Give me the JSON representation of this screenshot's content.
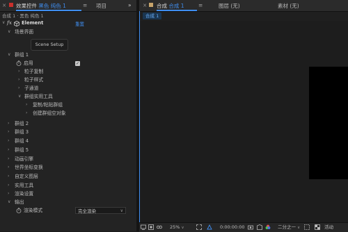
{
  "left_panel": {
    "tab_label_prefix": "效果控件",
    "tab_label_layer": "黑色 纯色 1",
    "tab_menu_glyph": "≡",
    "project_tab": "项目",
    "overflow_glyph": "»",
    "breadcrumb": "合成 1 · 黑色 纯色 1",
    "effect": {
      "fx_label": "fx",
      "name": "Element",
      "reset_label": "重置"
    },
    "scene_section": "场景界面",
    "scene_button": "Scene Setup",
    "group1": {
      "label": "群组 1",
      "enable_label": "启用",
      "items": [
        "粒子复制",
        "粒子样式",
        "子通道",
        "群组实用工具"
      ],
      "sub_items": [
        "复制/粘贴群组",
        "创建群组空对象"
      ]
    },
    "groups_collapsed": [
      "群组 2",
      "群组 3",
      "群组 4",
      "群组 5"
    ],
    "sections": [
      "动画引擎",
      "世界坐标变换",
      "自定义图层",
      "实用工具",
      "渲染设置",
      "输出"
    ],
    "render_mode_label": "渲染模式",
    "render_mode_value": "完全渲染"
  },
  "right_panel": {
    "comp_tab_prefix": "合成",
    "comp_tab_name": "合成 1",
    "comp_tab_menu": "≡",
    "layer_tab": "图层 (无)",
    "footage_tab": "素材 (无)",
    "comp_subtab": "合成 1"
  },
  "bottom_bar": {
    "zoom": "25%",
    "timecode": "0:00:00:00",
    "resolution": "二分之一",
    "active_camera": "活动"
  },
  "colors": {
    "accent": "#3f8ef0",
    "solid_swatch": "#c9302c",
    "comp_swatch": "#c7a46b"
  }
}
